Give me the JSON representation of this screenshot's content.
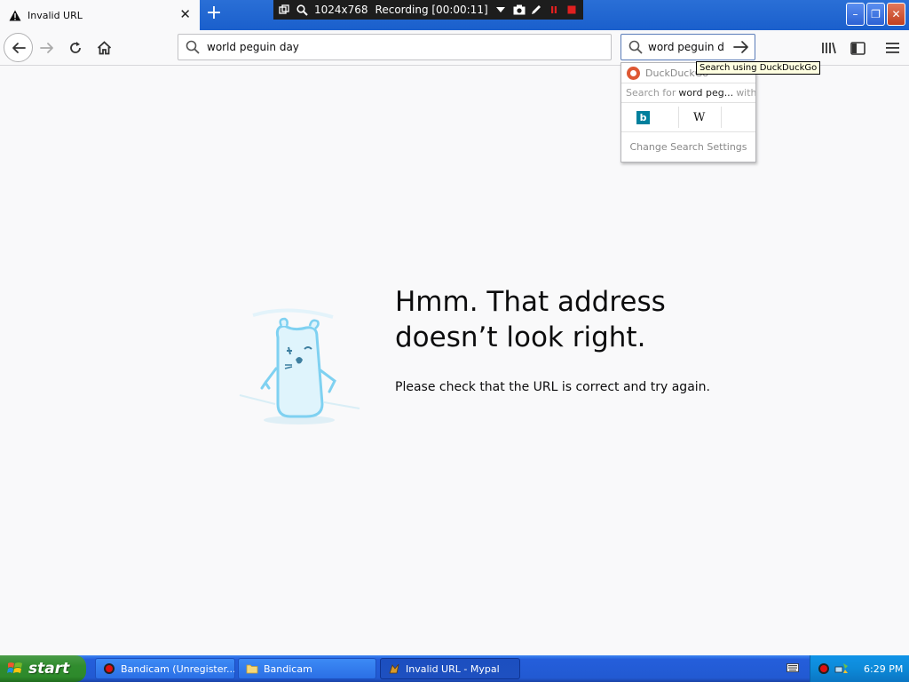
{
  "tab": {
    "title": "Invalid URL",
    "close": "✕",
    "new_tab": "+"
  },
  "recorder": {
    "resolution": "1024x768",
    "status": "Recording [00:00:11]"
  },
  "window_controls": {
    "minimize": "–",
    "maximize": "❐",
    "close": "✕"
  },
  "navbar": {
    "url_text": "world peguin day",
    "search_text": "word peguin d"
  },
  "search_popup": {
    "engine_name": "DuckDuckGo",
    "search_for_prefix": "Search for",
    "search_for_query": "word peg...",
    "search_for_suffix": "with:",
    "wiki_glyph": "W",
    "bing_glyph": "b",
    "change_settings": "Change Search Settings"
  },
  "tooltip": "Search using DuckDuckGo",
  "error": {
    "title_line1": "Hmm. That address",
    "title_line2": "doesn’t look right.",
    "description": "Please check that the URL is correct and try again."
  },
  "taskbar": {
    "start_label": "start",
    "tasks": [
      {
        "label": "Bandicam (Unregister..."
      },
      {
        "label": "Bandicam"
      },
      {
        "label": "Invalid URL - Mypal"
      }
    ],
    "clock": "6:29 PM"
  },
  "colors": {
    "accent": "#0a84ff",
    "page_bg": "#f9f9fa",
    "taskbar_blue": "#245edb",
    "start_green": "#308c2e",
    "ddg_orange": "#de5833",
    "bing_teal": "#00809d",
    "illustration_blue": "#7fd1f1"
  }
}
